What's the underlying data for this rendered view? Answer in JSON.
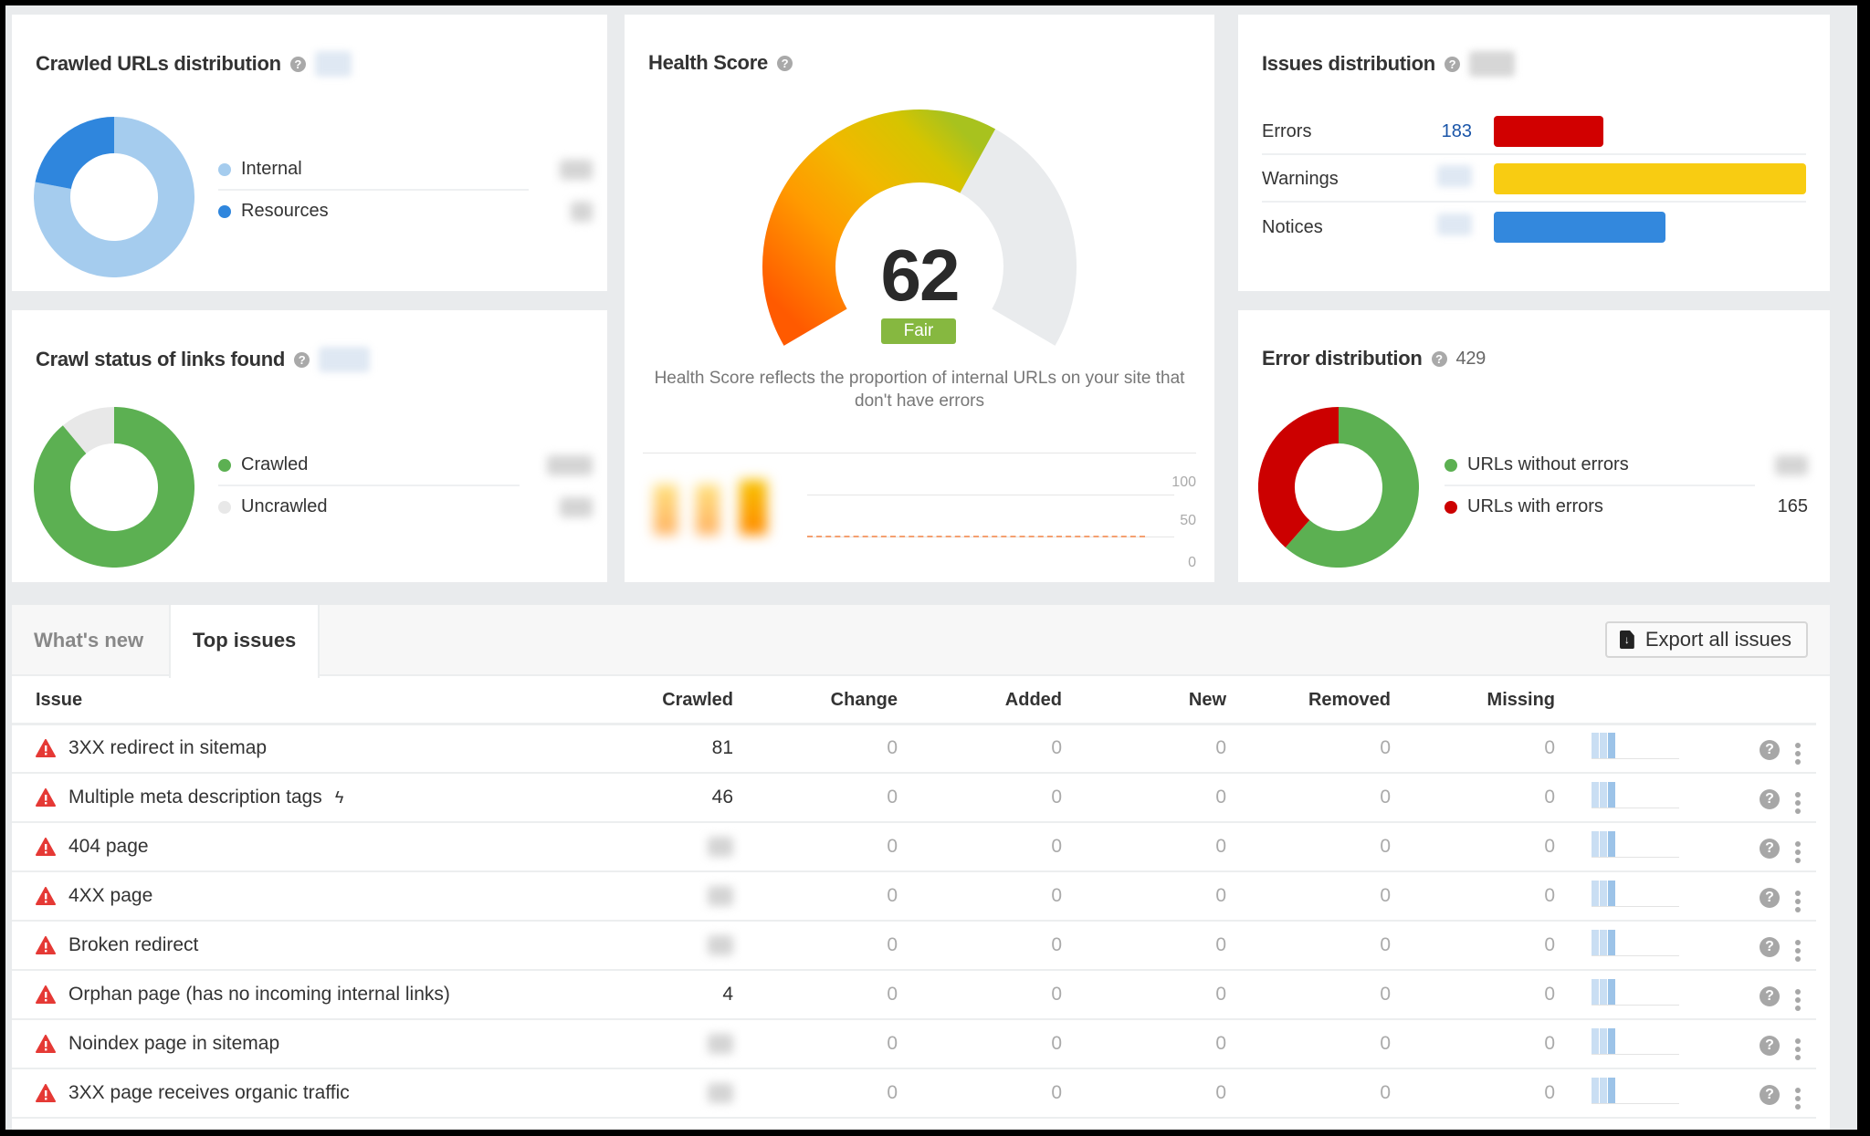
{
  "help_glyph": "?",
  "crawled_urls": {
    "title": "Crawled URLs distribution",
    "total_hidden": true,
    "segments": [
      {
        "label": "Internal",
        "share": 0.78,
        "color": "#a5ccee"
      },
      {
        "label": "Resources",
        "share": 0.22,
        "color": "#2f86dd"
      }
    ]
  },
  "crawl_status": {
    "title": "Crawl status of links found",
    "segments": [
      {
        "label": "Crawled",
        "share": 0.89,
        "color": "#5cb052"
      },
      {
        "label": "Uncrawled",
        "share": 0.11,
        "color": "#e8e8e8"
      }
    ]
  },
  "health_score": {
    "title": "Health Score",
    "score": "62",
    "score_value": 62,
    "score_max": 100,
    "rating": "Fair",
    "rating_color": "#86b840",
    "description": "Health Score reflects the proportion of internal URLs on your site that don't have errors",
    "history_axis": [
      "100",
      "50",
      "0"
    ]
  },
  "issues_distribution": {
    "title": "Issues distribution",
    "rows": [
      {
        "label": "Errors",
        "count": "183",
        "share": 0.35,
        "color": "#d10000"
      },
      {
        "label": "Warnings",
        "count": "",
        "share": 1.0,
        "color": "#f8cc12"
      },
      {
        "label": "Notices",
        "count": "",
        "share": 0.55,
        "color": "#3388dd"
      }
    ]
  },
  "error_distribution": {
    "title": "Error distribution",
    "total": "429",
    "segments": [
      {
        "label": "URLs without errors",
        "value": "",
        "share": 0.615,
        "color": "#5cb052"
      },
      {
        "label": "URLs with errors",
        "value": "165",
        "share": 0.385,
        "color": "#cc0000"
      }
    ]
  },
  "issues_table": {
    "tabs": [
      {
        "label": "What's new",
        "active": false
      },
      {
        "label": "Top issues",
        "active": true
      }
    ],
    "export_label": "Export all issues",
    "columns": [
      "Issue",
      "Crawled",
      "Change",
      "Added",
      "New",
      "Removed",
      "Missing"
    ],
    "rows": [
      {
        "issue": "3XX redirect in sitemap",
        "crawled": "81",
        "change": "0",
        "added": "0",
        "new": "0",
        "removed": "0",
        "missing": "0",
        "bolt": false
      },
      {
        "issue": "Multiple meta description tags",
        "crawled": "46",
        "change": "0",
        "added": "0",
        "new": "0",
        "removed": "0",
        "missing": "0",
        "bolt": true
      },
      {
        "issue": "404 page",
        "crawled": "",
        "change": "0",
        "added": "0",
        "new": "0",
        "removed": "0",
        "missing": "0",
        "bolt": false
      },
      {
        "issue": "4XX page",
        "crawled": "",
        "change": "0",
        "added": "0",
        "new": "0",
        "removed": "0",
        "missing": "0",
        "bolt": false
      },
      {
        "issue": "Broken redirect",
        "crawled": "",
        "change": "0",
        "added": "0",
        "new": "0",
        "removed": "0",
        "missing": "0",
        "bolt": false
      },
      {
        "issue": "Orphan page (has no incoming internal links)",
        "crawled": "4",
        "change": "0",
        "added": "0",
        "new": "0",
        "removed": "0",
        "missing": "0",
        "bolt": false
      },
      {
        "issue": "Noindex page in sitemap",
        "crawled": "",
        "change": "0",
        "added": "0",
        "new": "0",
        "removed": "0",
        "missing": "0",
        "bolt": false
      },
      {
        "issue": "3XX page receives organic traffic",
        "crawled": "",
        "change": "0",
        "added": "0",
        "new": "0",
        "removed": "0",
        "missing": "0",
        "bolt": false
      }
    ]
  },
  "colors": {
    "error_icon": "#e53935",
    "sparkline_light": "#c9def3",
    "sparkline_dark": "#9cc3e8"
  }
}
